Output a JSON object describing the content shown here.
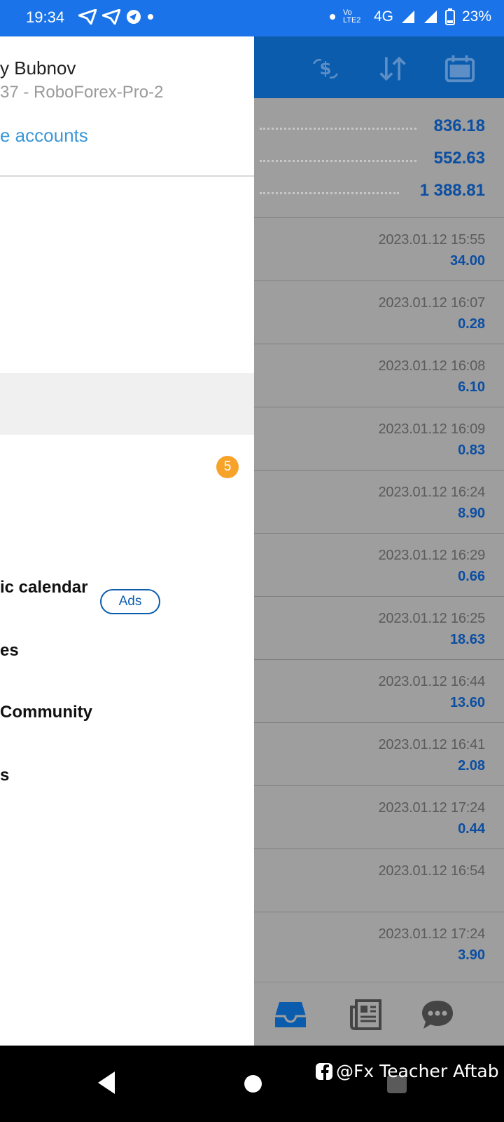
{
  "status_bar": {
    "time": "19:34",
    "network": "4G",
    "battery": "23%",
    "volte": "Vo LTE2"
  },
  "drawer": {
    "user_name": "y Bubnov",
    "account": "37 - RoboForex-Pro-2",
    "manage_accounts": "e accounts",
    "badge_count": "5",
    "menu_items": [
      "ic calendar",
      "es",
      "Community",
      "s"
    ],
    "ads_label": "Ads"
  },
  "summary": [
    {
      "value": "836.18"
    },
    {
      "value": "552.63"
    },
    {
      "value": "1 388.81"
    }
  ],
  "deals": [
    {
      "time": "2023.01.12 15:55",
      "amount": "34.00"
    },
    {
      "time": "2023.01.12 16:07",
      "amount": "0.28"
    },
    {
      "time": "2023.01.12 16:08",
      "amount": "6.10"
    },
    {
      "time": "2023.01.12 16:09",
      "amount": "0.83"
    },
    {
      "time": "2023.01.12 16:24",
      "amount": "8.90"
    },
    {
      "time": "2023.01.12 16:29",
      "amount": "0.66"
    },
    {
      "time": "2023.01.12 16:25",
      "amount": "18.63"
    },
    {
      "time": "2023.01.12 16:44",
      "amount": "13.60"
    },
    {
      "time": "2023.01.12 16:41",
      "amount": "2.08"
    },
    {
      "time": "2023.01.12 17:24",
      "amount": "0.44"
    },
    {
      "time": "2023.01.12 16:54",
      "amount": ""
    },
    {
      "time": "2023.01.12 17:24",
      "amount": "3.90"
    }
  ],
  "toolbar": {
    "icons": [
      "currency-exchange-icon",
      "sort-icon",
      "calendar-icon"
    ]
  },
  "tabbar": {
    "icons": [
      "inbox-icon",
      "news-icon",
      "chat-icon"
    ]
  },
  "watermark": "@Fx Teacher Aftab"
}
